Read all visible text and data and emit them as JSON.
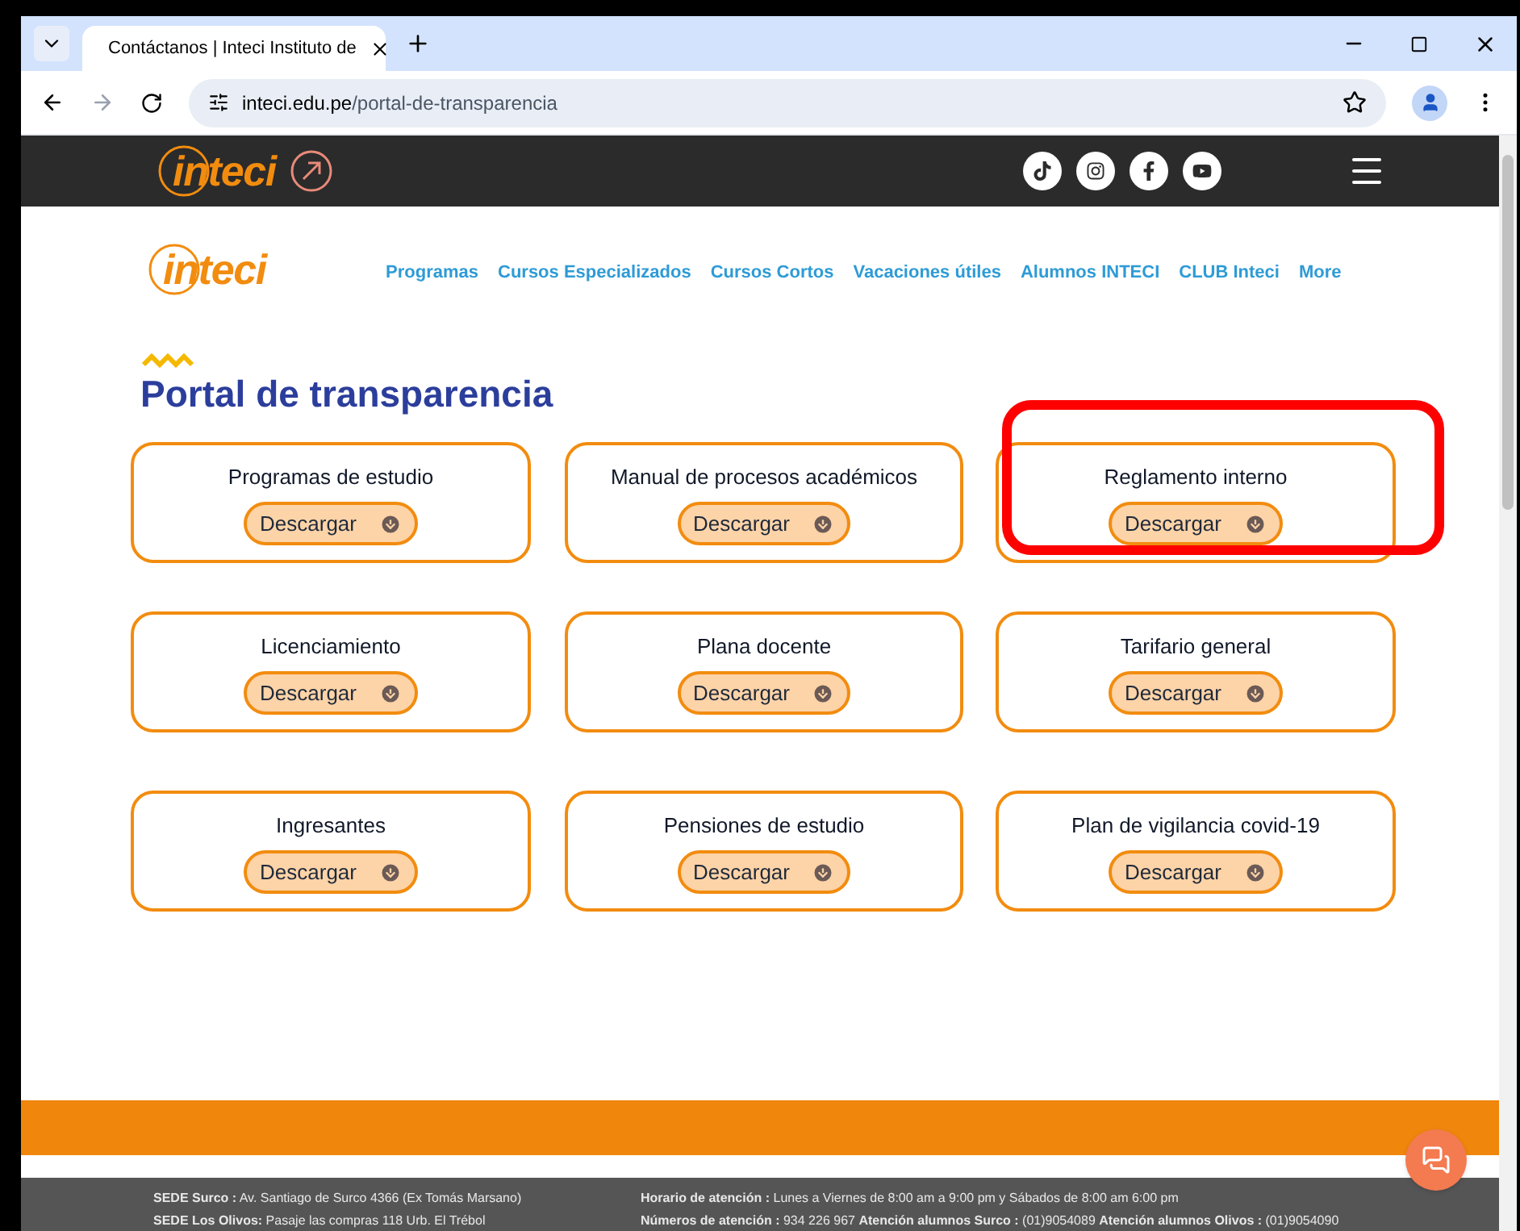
{
  "browser": {
    "tab_title": "Contáctanos | Inteci Instituto de",
    "url_domain": "inteci.edu.pe",
    "url_path": "/portal-de-transparencia"
  },
  "site_header": {
    "logo": "inteci",
    "social": [
      {
        "kind": "tiktok"
      },
      {
        "kind": "instagram"
      },
      {
        "kind": "facebook"
      },
      {
        "kind": "youtube"
      }
    ]
  },
  "nav": {
    "logo": "inteci",
    "items": [
      "Programas",
      "Cursos Especializados",
      "Cursos Cortos",
      "Vacaciones útiles",
      "Alumnos INTECI",
      "CLUB Inteci",
      "More"
    ]
  },
  "page_title": "Portal de transparencia",
  "documents": [
    {
      "title": "Programas de estudio",
      "button": "Descargar",
      "highlighted": false
    },
    {
      "title": "Manual de procesos académicos",
      "button": "Descargar",
      "highlighted": false
    },
    {
      "title": "Reglamento interno",
      "button": "Descargar",
      "highlighted": true
    },
    {
      "title": "Licenciamiento",
      "button": "Descargar",
      "highlighted": false
    },
    {
      "title": "Plana docente",
      "button": "Descargar",
      "highlighted": false
    },
    {
      "title": "Tarifario general",
      "button": "Descargar",
      "highlighted": false
    },
    {
      "title": "Ingresantes",
      "button": "Descargar",
      "highlighted": false
    },
    {
      "title": "Pensiones de estudio",
      "button": "Descargar",
      "highlighted": false
    },
    {
      "title": "Plan de vigilancia covid-19",
      "button": "Descargar",
      "highlighted": false
    }
  ],
  "footer": {
    "left": [
      "**SEDE Surco :** Av. Santiago de Surco 4366 (Ex Tomás Marsano)",
      "**SEDE Los Olivos:** Pasaje las compras 118 Urb.  El Trébol"
    ],
    "right": [
      "**Horario de atención :** Lunes a Viernes de 8:00 am a 9:00 pm y Sábados de 8:00 am 6:00 pm",
      "**Números de atención :** 934 226 967  **Atención alumnos Surco :** (01)9054089  **Atención alumnos Olivos :** (01)9054090"
    ]
  }
}
